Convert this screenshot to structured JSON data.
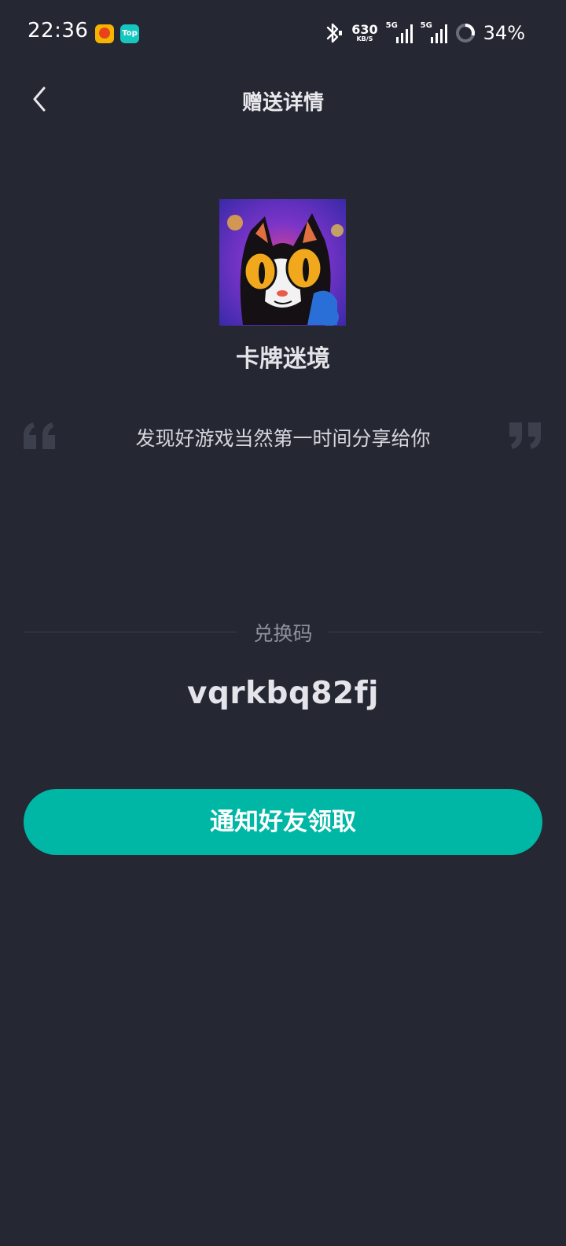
{
  "status_bar": {
    "time": "22:36",
    "net_speed_value": "630",
    "net_speed_unit": "KB/S",
    "signal_1_label": "5G",
    "signal_2_label": "5G",
    "battery": "34%",
    "top_app_label": "Top",
    "icons": [
      "fruit-app-icon",
      "top-app-icon",
      "bluetooth-icon",
      "signal-icon",
      "battery-icon"
    ]
  },
  "nav": {
    "title": "赠送详情",
    "back_icon": "chevron-left-icon"
  },
  "game": {
    "name": "卡牌迷境"
  },
  "message": {
    "text": "发现好游戏当然第一时间分享给你"
  },
  "redeem": {
    "label": "兑换码",
    "code": "vqrkbq82fj"
  },
  "actions": {
    "notify_label": "通知好友领取"
  },
  "colors": {
    "background": "#252733",
    "accent": "#00b7a6",
    "muted_text": "#8f919c"
  }
}
